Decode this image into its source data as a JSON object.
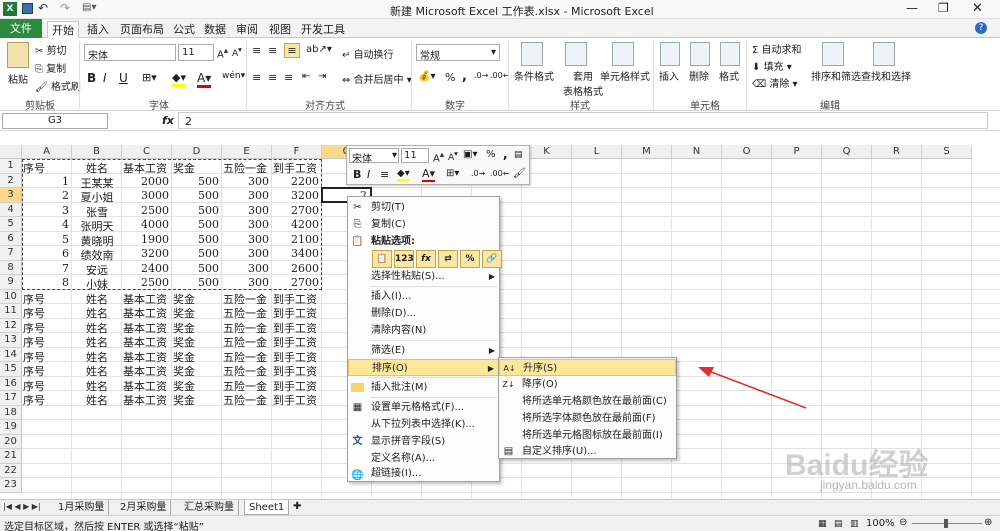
{
  "title": "新建 Microsoft Excel 工作表.xlsx - Microsoft Excel",
  "tabs": [
    "文件",
    "开始",
    "插入",
    "页面布局",
    "公式",
    "数据",
    "审阅",
    "视图",
    "开发工具"
  ],
  "ribbon": {
    "clipboard": {
      "paste": "粘贴",
      "cut": "剪切",
      "copy": "复制",
      "painter": "格式刷",
      "label": "剪贴板"
    },
    "font": {
      "name": "宋体",
      "size": "11",
      "bold": "B",
      "italic": "I",
      "underline": "U",
      "label": "字体",
      "wen": "wén"
    },
    "align": {
      "wrap": "自动换行",
      "merge": "合并后居中",
      "label": "对齐方式"
    },
    "number": {
      "format": "常规",
      "pct": "%",
      "comma": ",",
      "label": "数字"
    },
    "styles": {
      "cond": "条件格式",
      "table": "套用",
      "table2": "表格格式",
      "cell": "单元格样式",
      "label": "样式"
    },
    "cells": {
      "insert": "插入",
      "delete": "删除",
      "format": "格式",
      "label": "单元格"
    },
    "edit": {
      "sum": "Σ 自动求和",
      "fill": "填充",
      "clear": "清除",
      "sort": "排序和筛选",
      "find": "查找和选择",
      "label": "编辑"
    }
  },
  "formula": {
    "namebox": "G3",
    "fx": "fx",
    "value": "2"
  },
  "columns": [
    "A",
    "B",
    "C",
    "D",
    "E",
    "F",
    "G",
    "H",
    "I",
    "J",
    "K",
    "L",
    "M",
    "N",
    "O",
    "P",
    "Q",
    "R",
    "S"
  ],
  "rows": [
    "1",
    "2",
    "3",
    "4",
    "5",
    "6",
    "7",
    "8",
    "9",
    "10",
    "11",
    "12",
    "13",
    "14",
    "15",
    "16",
    "17",
    "18",
    "19",
    "20",
    "21",
    "22",
    "23"
  ],
  "header": [
    "序号",
    "姓名",
    "基本工资",
    "奖金",
    "五险一金",
    "到手工资"
  ],
  "data": [
    [
      "1",
      "王某某",
      "2000",
      "500",
      "300",
      "2200"
    ],
    [
      "2",
      "夏小姐",
      "3000",
      "500",
      "300",
      "3200"
    ],
    [
      "3",
      "张雪",
      "2500",
      "500",
      "300",
      "2700"
    ],
    [
      "4",
      "张明天",
      "4000",
      "500",
      "300",
      "4200"
    ],
    [
      "5",
      "黄晓明",
      "1900",
      "500",
      "300",
      "2100"
    ],
    [
      "6",
      "绩效南",
      "3200",
      "500",
      "300",
      "3400"
    ],
    [
      "7",
      "安远",
      "2400",
      "500",
      "300",
      "2600"
    ],
    [
      "8",
      "小妹",
      "2500",
      "500",
      "300",
      "2700"
    ]
  ],
  "g3": "2",
  "minitoolbar": {
    "font": "宋体",
    "size": "11",
    "pct": "%",
    "comma": ","
  },
  "contextmenu": {
    "cut": "剪切(T)",
    "copy": "复制(C)",
    "paste_options": "粘贴选项:",
    "paste_icons": [
      "📋",
      "123",
      "fx",
      "⇄",
      "%",
      "🔗"
    ],
    "paste_special": "选择性粘贴(S)...",
    "insert": "插入(I)...",
    "delete": "删除(D)...",
    "clear": "清除内容(N)",
    "filter": "筛选(E)",
    "sort": "排序(O)",
    "comment": "插入批注(M)",
    "format": "设置单元格格式(F)...",
    "dropdown": "从下拉列表中选择(K)...",
    "phonetic": "显示拼音字段(S)",
    "define": "定义名称(A)...",
    "hyperlink": "超链接(I)..."
  },
  "submenu": [
    "升序(S)",
    "降序(O)",
    "将所选单元格颜色放在最前面(C)",
    "将所选字体颜色放在最前面(F)",
    "将所选单元格图标放在最前面(I)",
    "自定义排序(U)..."
  ],
  "sheets": [
    "1月采购量",
    "2月采购量",
    "汇总采购量",
    "Sheet1"
  ],
  "status": "选定目标区域，然后按 ENTER 或选择“粘贴”",
  "zoom": "100%",
  "watermark": "Baidu经验",
  "watermark_url": "jingyan.baidu.com"
}
